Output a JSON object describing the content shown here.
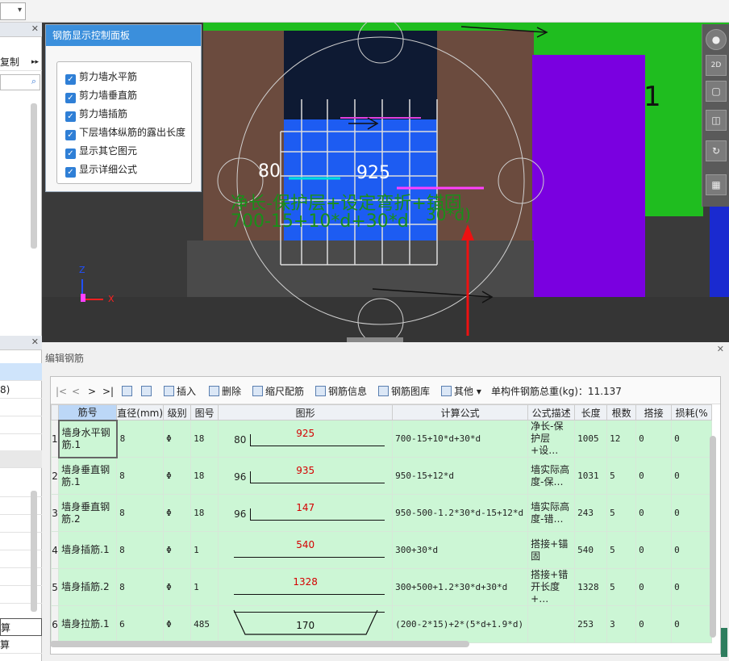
{
  "left_panel": {
    "header_label": "复制",
    "rows": [
      "8)",
      "算",
      "算"
    ]
  },
  "control_panel": {
    "title": "钢筋显示控制面板",
    "options": [
      {
        "label": "剪力墙水平筋",
        "checked": true
      },
      {
        "label": "剪力墙垂直筋",
        "checked": true
      },
      {
        "label": "剪力墙插筋",
        "checked": true
      },
      {
        "label": "下层墙体纵筋的露出长度",
        "checked": true
      },
      {
        "label": "显示其它图元",
        "checked": true
      },
      {
        "label": "显示详细公式",
        "checked": true
      }
    ]
  },
  "viewport": {
    "dim_left": "80",
    "dim_mid": "925",
    "formula_text": "净长-保护层+设定弯折+锚固",
    "formula_values": "700-15+10*d+30*d",
    "formula_extra": "30*d)",
    "axis_z": "Z",
    "axis_x": "X",
    "side_label": "1",
    "colors": {
      "green": "#1fbd1f",
      "purple": "#7a00e0",
      "blue": "#1d5cf2",
      "brown": "#6b4b3e"
    }
  },
  "right_toolbar": {
    "labels": [
      "2D"
    ]
  },
  "editor": {
    "title": "编辑钢筋",
    "toolbar": {
      "nav": [
        "|<",
        "<",
        ">",
        ">|"
      ],
      "insert": "插入",
      "delete": "删除",
      "scale": "缩尺配筋",
      "info": "钢筋信息",
      "library": "钢筋图库",
      "other": "其他",
      "total_label": "单构件钢筋总重(kg)：11.137"
    },
    "columns": [
      "筋号",
      "直径(mm)",
      "级别",
      "图号",
      "图形",
      "计算公式",
      "公式描述",
      "长度",
      "根数",
      "搭接",
      "损耗(%"
    ],
    "rows": [
      {
        "idx": "1",
        "name": "墙身水平钢筋.1",
        "dia": "8",
        "grade": "Φ",
        "fig": "18",
        "shape_left": "80",
        "shape_mid": "925",
        "formula": "700-15+10*d+30*d",
        "desc": "净长-保护层+设…",
        "length": "1005",
        "count": "12",
        "lap": "0",
        "loss": "0"
      },
      {
        "idx": "2",
        "name": "墙身垂直钢筋.1",
        "dia": "8",
        "grade": "Φ",
        "fig": "18",
        "shape_left": "96",
        "shape_mid": "935",
        "formula": "950-15+12*d",
        "desc": "墙实际高度-保…",
        "length": "1031",
        "count": "5",
        "lap": "0",
        "loss": "0"
      },
      {
        "idx": "3",
        "name": "墙身垂直钢筋.2",
        "dia": "8",
        "grade": "Φ",
        "fig": "18",
        "shape_left": "96",
        "shape_mid": "147",
        "formula": "950-500-1.2*30*d-15+12*d",
        "desc": "墙实际高度-错…",
        "length": "243",
        "count": "5",
        "lap": "0",
        "loss": "0"
      },
      {
        "idx": "4",
        "name": "墙身插筋.1",
        "dia": "8",
        "grade": "Φ",
        "fig": "1",
        "shape_left": "",
        "shape_mid": "540",
        "formula": "300+30*d",
        "desc": "搭接+锚固",
        "length": "540",
        "count": "5",
        "lap": "0",
        "loss": "0"
      },
      {
        "idx": "5",
        "name": "墙身插筋.2",
        "dia": "8",
        "grade": "Φ",
        "fig": "1",
        "shape_left": "",
        "shape_mid": "1328",
        "formula": "300+500+1.2*30*d+30*d",
        "desc": "搭接+错开长度+…",
        "length": "1328",
        "count": "5",
        "lap": "0",
        "loss": "0"
      },
      {
        "idx": "6",
        "name": "墙身拉筋.1",
        "dia": "6",
        "grade": "Φ",
        "fig": "485",
        "shape_left": "",
        "shape_mid": "170",
        "formula": "(200-2*15)+2*(5*d+1.9*d)",
        "desc": "",
        "length": "253",
        "count": "3",
        "lap": "0",
        "loss": "0"
      }
    ]
  }
}
